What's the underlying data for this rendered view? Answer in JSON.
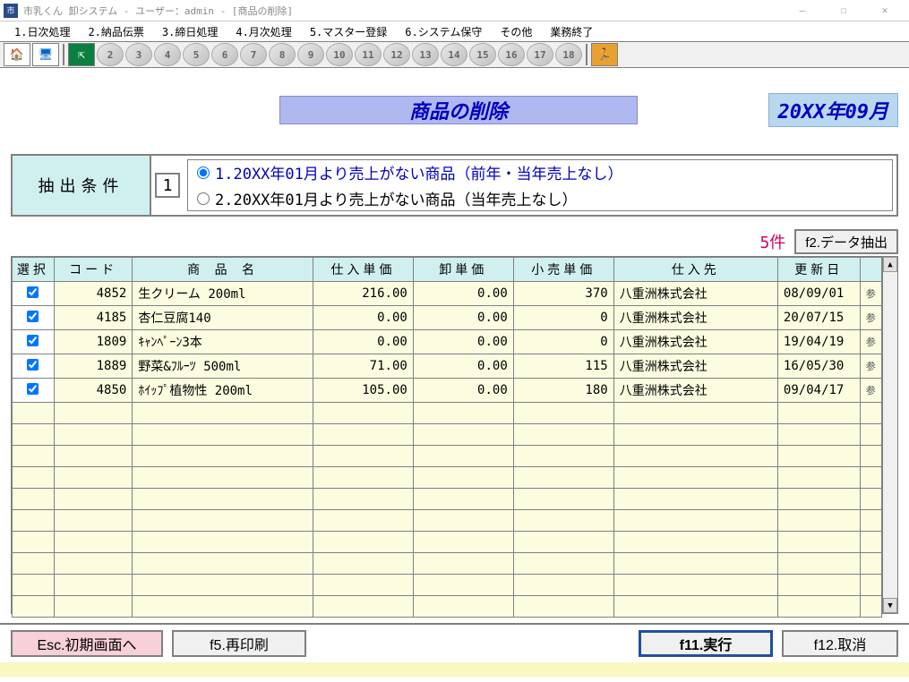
{
  "window": {
    "title": "市乳くん 卸システム - ユーザー：admin - [商品の削除]"
  },
  "menu": {
    "items": [
      "1.日次処理",
      "2.納品伝票",
      "3.締日処理",
      "4.月次処理",
      "5.マスター登録",
      "6.システム保守",
      "その他",
      "業務終了"
    ]
  },
  "page": {
    "title": "商品の削除",
    "period": "20XX年09月"
  },
  "condition": {
    "label": "抽出条件",
    "selected": "1",
    "option1": "1.20XX年01月より売上がない商品（前年・当年売上なし）",
    "option2": "2.20XX年01月より売上がない商品（当年売上なし）"
  },
  "count": "5件",
  "extract_btn": "f2.データ抽出",
  "columns": {
    "select": "選択",
    "code": "コード",
    "name": "商 品 名",
    "cost": "仕入単価",
    "wholesale": "卸単価",
    "retail": "小売単価",
    "supplier": "仕入先",
    "updated": "更新日",
    "ref": ""
  },
  "rows": [
    {
      "checked": true,
      "code": "4852",
      "name": "生クリーム 200ml",
      "cost": "216.00",
      "wholesale": "0.00",
      "retail": "370",
      "supplier": "八重洲株式会社",
      "updated": "08/09/01",
      "ref": "参"
    },
    {
      "checked": true,
      "code": "4185",
      "name": "杏仁豆腐140",
      "cost": "0.00",
      "wholesale": "0.00",
      "retail": "0",
      "supplier": "八重洲株式会社",
      "updated": "20/07/15",
      "ref": "参"
    },
    {
      "checked": true,
      "code": "1809",
      "name": "ｷｬﾝﾍﾟｰﾝ3本",
      "cost": "0.00",
      "wholesale": "0.00",
      "retail": "0",
      "supplier": "八重洲株式会社",
      "updated": "19/04/19",
      "ref": "参"
    },
    {
      "checked": true,
      "code": "1889",
      "name": "野菜&ﾌﾙｰﾂ 500ml",
      "cost": "71.00",
      "wholesale": "0.00",
      "retail": "115",
      "supplier": "八重洲株式会社",
      "updated": "16/05/30",
      "ref": "参"
    },
    {
      "checked": true,
      "code": "4850",
      "name": "ﾎｲｯﾌﾟ植物性 200ml",
      "cost": "105.00",
      "wholesale": "0.00",
      "retail": "180",
      "supplier": "八重洲株式会社",
      "updated": "09/04/17",
      "ref": "参"
    }
  ],
  "footer": {
    "esc": "Esc.初期画面へ",
    "f5": "f5.再印刷",
    "f11": "f11.実行",
    "f12": "f12.取消"
  }
}
